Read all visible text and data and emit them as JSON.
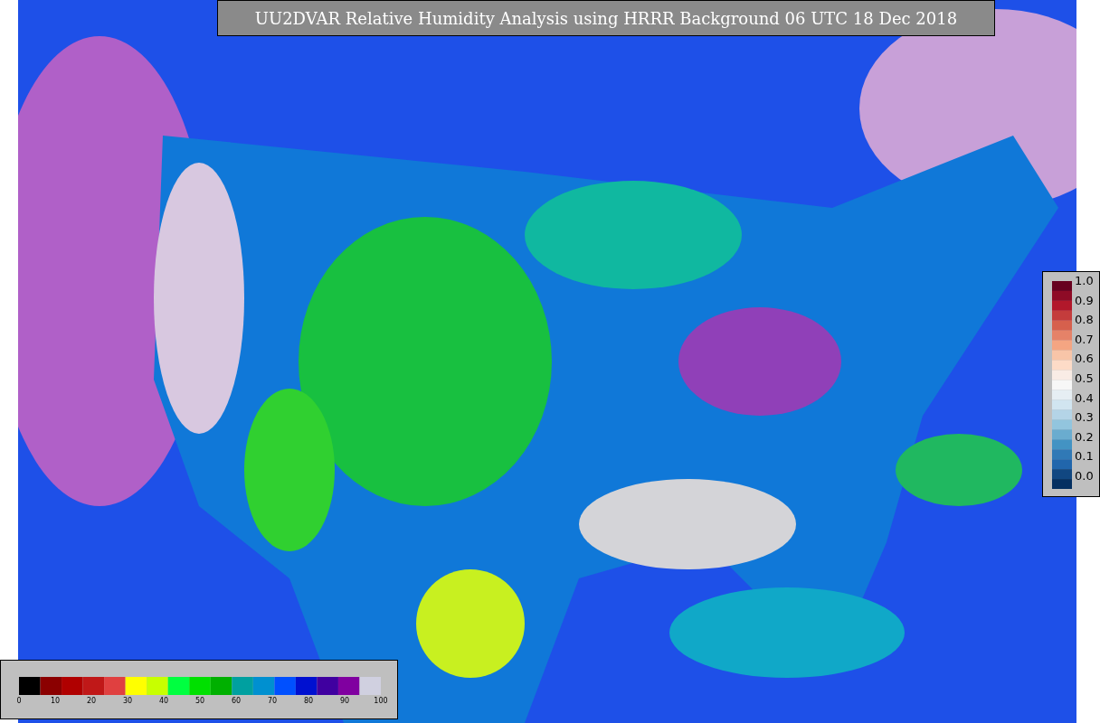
{
  "title": "UU2DVAR Relative Humidity Analysis using HRRR Background 06 UTC 18 Dec 2018",
  "ratio_legend": {
    "ticks": [
      "1.0",
      "0.9",
      "0.8",
      "0.7",
      "0.6",
      "0.5",
      "0.4",
      "0.3",
      "0.2",
      "0.1",
      "0.0"
    ]
  },
  "humidity_legend": {
    "ticks": [
      "0",
      "10",
      "20",
      "30",
      "40",
      "50",
      "60",
      "70",
      "80",
      "90",
      "100"
    ]
  }
}
